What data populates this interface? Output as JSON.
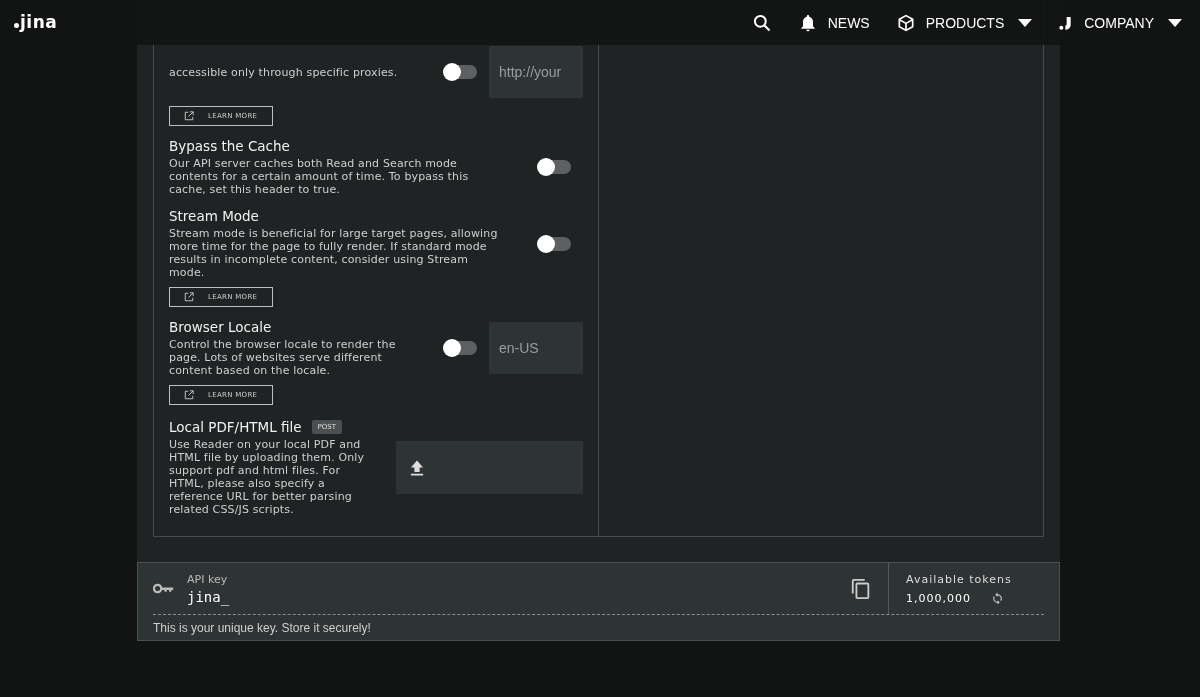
{
  "nav": {
    "logo": "jina",
    "items": [
      {
        "kind": "search"
      },
      {
        "kind": "news",
        "label": "NEWS",
        "dropdown": false
      },
      {
        "kind": "products",
        "label": "PRODUCTS",
        "dropdown": true
      },
      {
        "kind": "company",
        "label": "COMPANY",
        "dropdown": true
      }
    ]
  },
  "settings": [
    {
      "kind": "toggle-input",
      "description": "accessible only through specific proxies.",
      "on": false,
      "input": {
        "placeholder": "http://your"
      },
      "learn_more": "LEARN MORE"
    },
    {
      "kind": "toggle",
      "title": "Bypass the Cache",
      "description": "Our API server caches both Read and Search mode contents for a certain amount of time. To bypass this cache, set this header to true.",
      "on": false
    },
    {
      "kind": "toggle",
      "title": "Stream Mode",
      "description": "Stream mode is beneficial for large target pages, allowing more time for the page to fully render. If standard mode results in incomplete content, consider using Stream mode.",
      "on": false,
      "learn_more": "LEARN MORE"
    },
    {
      "kind": "toggle-input",
      "title": "Browser Locale",
      "description": "Control the browser locale to render the page. Lots of websites serve different content based on the locale.",
      "on": false,
      "input": {
        "placeholder": "en-US"
      },
      "learn_more": "LEARN MORE"
    },
    {
      "kind": "upload",
      "title": "Local PDF/HTML file",
      "badge": "POST",
      "description": "Use Reader on your local PDF and HTML file by uploading them. Only support pdf and html files. For HTML, please also specify a reference URL for better parsing related CSS/JS scripts."
    }
  ],
  "api_key": {
    "label": "API key",
    "value": "jina_",
    "hint": "This is your unique key. Store it securely!",
    "tokens_label": "Available tokens",
    "tokens": "1,000,000"
  }
}
